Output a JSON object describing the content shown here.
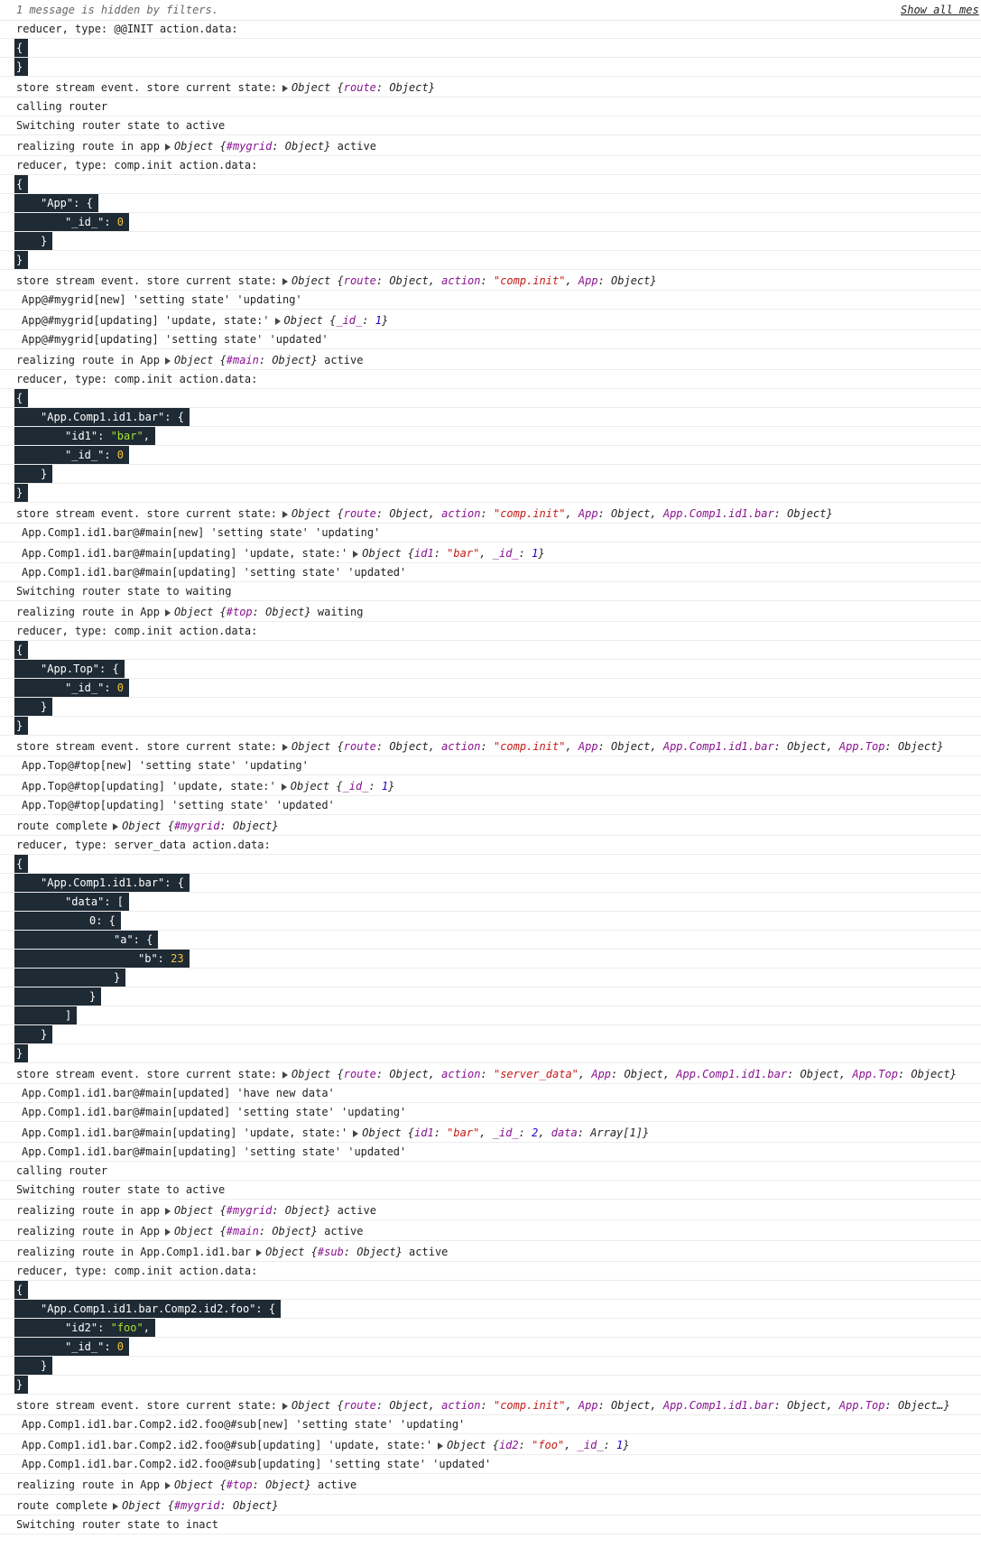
{
  "header": {
    "hidden_message": "1 message is hidden by filters.",
    "show_all": "Show all mes"
  },
  "lines": [
    {
      "t": "text",
      "x": "reducer, type: @@INIT action.data:"
    },
    {
      "t": "json",
      "v": [
        [
          0,
          "{"
        ]
      ]
    },
    {
      "t": "json",
      "v": [
        [
          0,
          "}"
        ]
      ]
    },
    {
      "t": "log",
      "pre": "store stream event. store current state:",
      "obj": [
        [
          "k",
          "route"
        ],
        [
          ": Object"
        ]
      ],
      "post": ""
    },
    {
      "t": "text",
      "x": "calling router"
    },
    {
      "t": "text",
      "x": "Switching router state to  active"
    },
    {
      "t": "log",
      "pre": "realizing route in app",
      "obj": [
        [
          "k",
          "#mygrid"
        ],
        [
          ": Object"
        ]
      ],
      "post": " active"
    },
    {
      "t": "text",
      "x": "reducer, type: comp.init action.data:"
    },
    {
      "t": "json",
      "v": [
        [
          0,
          "{"
        ]
      ]
    },
    {
      "t": "json",
      "v": [
        [
          1,
          "\"App\": {"
        ]
      ]
    },
    {
      "t": "json",
      "v": [
        [
          2,
          "\"_id_\": "
        ],
        [
          "num",
          "0"
        ]
      ]
    },
    {
      "t": "json",
      "v": [
        [
          1,
          "}"
        ]
      ]
    },
    {
      "t": "json",
      "v": [
        [
          0,
          "}"
        ]
      ]
    },
    {
      "t": "log",
      "pre": "store stream event. store current state:",
      "obj": [
        [
          "k",
          "route"
        ],
        [
          ": Object, "
        ],
        [
          "k",
          "action"
        ],
        [
          ": "
        ],
        [
          "s",
          "\"comp.init\""
        ],
        [
          ", "
        ],
        [
          "k",
          "App"
        ],
        [
          ": Object"
        ]
      ],
      "post": ""
    },
    {
      "t": "ind",
      "x": "App@#mygrid[new] 'setting state' 'updating'"
    },
    {
      "t": "logi",
      "pre": "App@#mygrid[updating] 'update, state:'",
      "obj": [
        [
          "k",
          "_id_"
        ],
        [
          ": "
        ],
        [
          "n",
          "1"
        ]
      ],
      "post": ""
    },
    {
      "t": "ind",
      "x": "App@#mygrid[updating] 'setting state' 'updated'"
    },
    {
      "t": "log",
      "pre": "realizing route in App",
      "obj": [
        [
          "k",
          "#main"
        ],
        [
          ": Object"
        ]
      ],
      "post": " active"
    },
    {
      "t": "text",
      "x": "reducer, type: comp.init action.data:"
    },
    {
      "t": "json",
      "v": [
        [
          0,
          "{"
        ]
      ]
    },
    {
      "t": "json",
      "v": [
        [
          1,
          "\"App.Comp1.id1.bar\": {"
        ]
      ]
    },
    {
      "t": "json",
      "v": [
        [
          2,
          "\"id1\": "
        ],
        [
          "str",
          "\"bar\""
        ],
        [
          ",",
          ""
        ]
      ]
    },
    {
      "t": "json",
      "v": [
        [
          2,
          "\"_id_\": "
        ],
        [
          "num",
          "0"
        ]
      ]
    },
    {
      "t": "json",
      "v": [
        [
          1,
          "}"
        ]
      ]
    },
    {
      "t": "json",
      "v": [
        [
          0,
          "}"
        ]
      ]
    },
    {
      "t": "log",
      "pre": "store stream event. store current state:",
      "obj": [
        [
          "k",
          "route"
        ],
        [
          ": Object, "
        ],
        [
          "k",
          "action"
        ],
        [
          ": "
        ],
        [
          "s",
          "\"comp.init\""
        ],
        [
          ", "
        ],
        [
          "k",
          "App"
        ],
        [
          ": Object, "
        ],
        [
          "k",
          "App.Comp1.id1.bar"
        ],
        [
          ": Object"
        ]
      ],
      "post": ""
    },
    {
      "t": "ind",
      "x": "App.Comp1.id1.bar@#main[new] 'setting state' 'updating'"
    },
    {
      "t": "logi",
      "pre": "App.Comp1.id1.bar@#main[updating] 'update, state:'",
      "obj": [
        [
          "k",
          "id1"
        ],
        [
          ": "
        ],
        [
          "s",
          "\"bar\""
        ],
        [
          ", "
        ],
        [
          "k",
          "_id_"
        ],
        [
          ": "
        ],
        [
          "n",
          "1"
        ]
      ],
      "post": ""
    },
    {
      "t": "ind",
      "x": "App.Comp1.id1.bar@#main[updating] 'setting state' 'updated'"
    },
    {
      "t": "text",
      "x": "Switching router state to  waiting"
    },
    {
      "t": "log",
      "pre": "realizing route in App",
      "obj": [
        [
          "k",
          "#top"
        ],
        [
          ": Object"
        ]
      ],
      "post": " waiting"
    },
    {
      "t": "text",
      "x": "reducer, type: comp.init action.data:"
    },
    {
      "t": "json",
      "v": [
        [
          0,
          "{"
        ]
      ]
    },
    {
      "t": "json",
      "v": [
        [
          1,
          "\"App.Top\": {"
        ]
      ]
    },
    {
      "t": "json",
      "v": [
        [
          2,
          "\"_id_\": "
        ],
        [
          "num",
          "0"
        ]
      ]
    },
    {
      "t": "json",
      "v": [
        [
          1,
          "}"
        ]
      ]
    },
    {
      "t": "json",
      "v": [
        [
          0,
          "}"
        ]
      ]
    },
    {
      "t": "log",
      "pre": "store stream event. store current state:",
      "obj": [
        [
          "k",
          "route"
        ],
        [
          ": Object, "
        ],
        [
          "k",
          "action"
        ],
        [
          ": "
        ],
        [
          "s",
          "\"comp.init\""
        ],
        [
          ", "
        ],
        [
          "k",
          "App"
        ],
        [
          ": Object, "
        ],
        [
          "k",
          "App.Comp1.id1.bar"
        ],
        [
          ": Object, "
        ],
        [
          "k",
          "App.Top"
        ],
        [
          ": Object"
        ]
      ],
      "post": ""
    },
    {
      "t": "ind",
      "x": "App.Top@#top[new] 'setting state' 'updating'"
    },
    {
      "t": "logi",
      "pre": "App.Top@#top[updating] 'update, state:'",
      "obj": [
        [
          "k",
          "_id_"
        ],
        [
          ": "
        ],
        [
          "n",
          "1"
        ]
      ],
      "post": ""
    },
    {
      "t": "ind",
      "x": "App.Top@#top[updating] 'setting state' 'updated'"
    },
    {
      "t": "log",
      "pre": "route complete",
      "obj": [
        [
          "k",
          "#mygrid"
        ],
        [
          ": Object"
        ]
      ],
      "post": ""
    },
    {
      "t": "text",
      "x": "reducer, type: server_data action.data:"
    },
    {
      "t": "json",
      "v": [
        [
          0,
          "{"
        ]
      ]
    },
    {
      "t": "json",
      "v": [
        [
          1,
          "\"App.Comp1.id1.bar\": {"
        ]
      ]
    },
    {
      "t": "json",
      "v": [
        [
          2,
          "\"data\": ["
        ]
      ]
    },
    {
      "t": "json",
      "v": [
        [
          3,
          "0: {"
        ]
      ]
    },
    {
      "t": "json",
      "v": [
        [
          4,
          "\"a\": {"
        ]
      ]
    },
    {
      "t": "json",
      "v": [
        [
          5,
          "\"b\": "
        ],
        [
          "num",
          "23"
        ]
      ]
    },
    {
      "t": "json",
      "v": [
        [
          4,
          "}"
        ]
      ]
    },
    {
      "t": "json",
      "v": [
        [
          3,
          "}"
        ]
      ]
    },
    {
      "t": "json",
      "v": [
        [
          2,
          "]"
        ]
      ]
    },
    {
      "t": "json",
      "v": [
        [
          1,
          "}"
        ]
      ]
    },
    {
      "t": "json",
      "v": [
        [
          0,
          "}"
        ]
      ]
    },
    {
      "t": "log",
      "pre": "store stream event. store current state:",
      "obj": [
        [
          "k",
          "route"
        ],
        [
          ": Object, "
        ],
        [
          "k",
          "action"
        ],
        [
          ": "
        ],
        [
          "s",
          "\"server_data\""
        ],
        [
          ", "
        ],
        [
          "k",
          "App"
        ],
        [
          ": Object, "
        ],
        [
          "k",
          "App.Comp1.id1.bar"
        ],
        [
          ": Object, "
        ],
        [
          "k",
          "App.Top"
        ],
        [
          ": Object"
        ]
      ],
      "post": ""
    },
    {
      "t": "ind",
      "x": "App.Comp1.id1.bar@#main[updated] 'have new data'"
    },
    {
      "t": "ind",
      "x": "App.Comp1.id1.bar@#main[updated] 'setting state' 'updating'"
    },
    {
      "t": "logi",
      "pre": "App.Comp1.id1.bar@#main[updating] 'update, state:'",
      "obj": [
        [
          "k",
          "id1"
        ],
        [
          ": "
        ],
        [
          "s",
          "\"bar\""
        ],
        [
          ", "
        ],
        [
          "k",
          "_id_"
        ],
        [
          ": "
        ],
        [
          "n",
          "2"
        ],
        [
          ", "
        ],
        [
          "k",
          "data"
        ],
        [
          ": Array[1]"
        ]
      ],
      "post": ""
    },
    {
      "t": "ind",
      "x": "App.Comp1.id1.bar@#main[updating] 'setting state' 'updated'"
    },
    {
      "t": "text",
      "x": "calling router"
    },
    {
      "t": "text",
      "x": "Switching router state to  active"
    },
    {
      "t": "log",
      "pre": "realizing route in app",
      "obj": [
        [
          "k",
          "#mygrid"
        ],
        [
          ": Object"
        ]
      ],
      "post": " active"
    },
    {
      "t": "log",
      "pre": "realizing route in App",
      "obj": [
        [
          "k",
          "#main"
        ],
        [
          ": Object"
        ]
      ],
      "post": " active"
    },
    {
      "t": "log",
      "pre": "realizing route in App.Comp1.id1.bar",
      "obj": [
        [
          "k",
          "#sub"
        ],
        [
          ": Object"
        ]
      ],
      "post": " active"
    },
    {
      "t": "text",
      "x": "reducer, type: comp.init action.data:"
    },
    {
      "t": "json",
      "v": [
        [
          0,
          "{"
        ]
      ]
    },
    {
      "t": "json",
      "v": [
        [
          1,
          "\"App.Comp1.id1.bar.Comp2.id2.foo\": {"
        ]
      ]
    },
    {
      "t": "json",
      "v": [
        [
          2,
          "\"id2\": "
        ],
        [
          "str",
          "\"foo\""
        ],
        [
          ",",
          ""
        ]
      ]
    },
    {
      "t": "json",
      "v": [
        [
          2,
          "\"_id_\": "
        ],
        [
          "num",
          "0"
        ]
      ]
    },
    {
      "t": "json",
      "v": [
        [
          1,
          "}"
        ]
      ]
    },
    {
      "t": "json",
      "v": [
        [
          0,
          "}"
        ]
      ]
    },
    {
      "t": "log",
      "pre": "store stream event. store current state:",
      "obj": [
        [
          "k",
          "route"
        ],
        [
          ": Object, "
        ],
        [
          "k",
          "action"
        ],
        [
          ": "
        ],
        [
          "s",
          "\"comp.init\""
        ],
        [
          ", "
        ],
        [
          "k",
          "App"
        ],
        [
          ": Object, "
        ],
        [
          "k",
          "App.Comp1.id1.bar"
        ],
        [
          ": Object, "
        ],
        [
          "k",
          "App.Top"
        ],
        [
          ": Object…"
        ]
      ],
      "post": ""
    },
    {
      "t": "ind",
      "x": "App.Comp1.id1.bar.Comp2.id2.foo@#sub[new] 'setting state' 'updating'"
    },
    {
      "t": "logi",
      "pre": "App.Comp1.id1.bar.Comp2.id2.foo@#sub[updating] 'update, state:'",
      "obj": [
        [
          "k",
          "id2"
        ],
        [
          ": "
        ],
        [
          "s",
          "\"foo\""
        ],
        [
          ", "
        ],
        [
          "k",
          "_id_"
        ],
        [
          ": "
        ],
        [
          "n",
          "1"
        ]
      ],
      "post": ""
    },
    {
      "t": "ind",
      "x": "App.Comp1.id1.bar.Comp2.id2.foo@#sub[updating] 'setting state' 'updated'"
    },
    {
      "t": "log",
      "pre": "realizing route in App",
      "obj": [
        [
          "k",
          "#top"
        ],
        [
          ": Object"
        ]
      ],
      "post": " active"
    },
    {
      "t": "log",
      "pre": "route complete",
      "obj": [
        [
          "k",
          "#mygrid"
        ],
        [
          ": Object"
        ]
      ],
      "post": ""
    },
    {
      "t": "text",
      "x": "Switching router state to  inact"
    }
  ]
}
